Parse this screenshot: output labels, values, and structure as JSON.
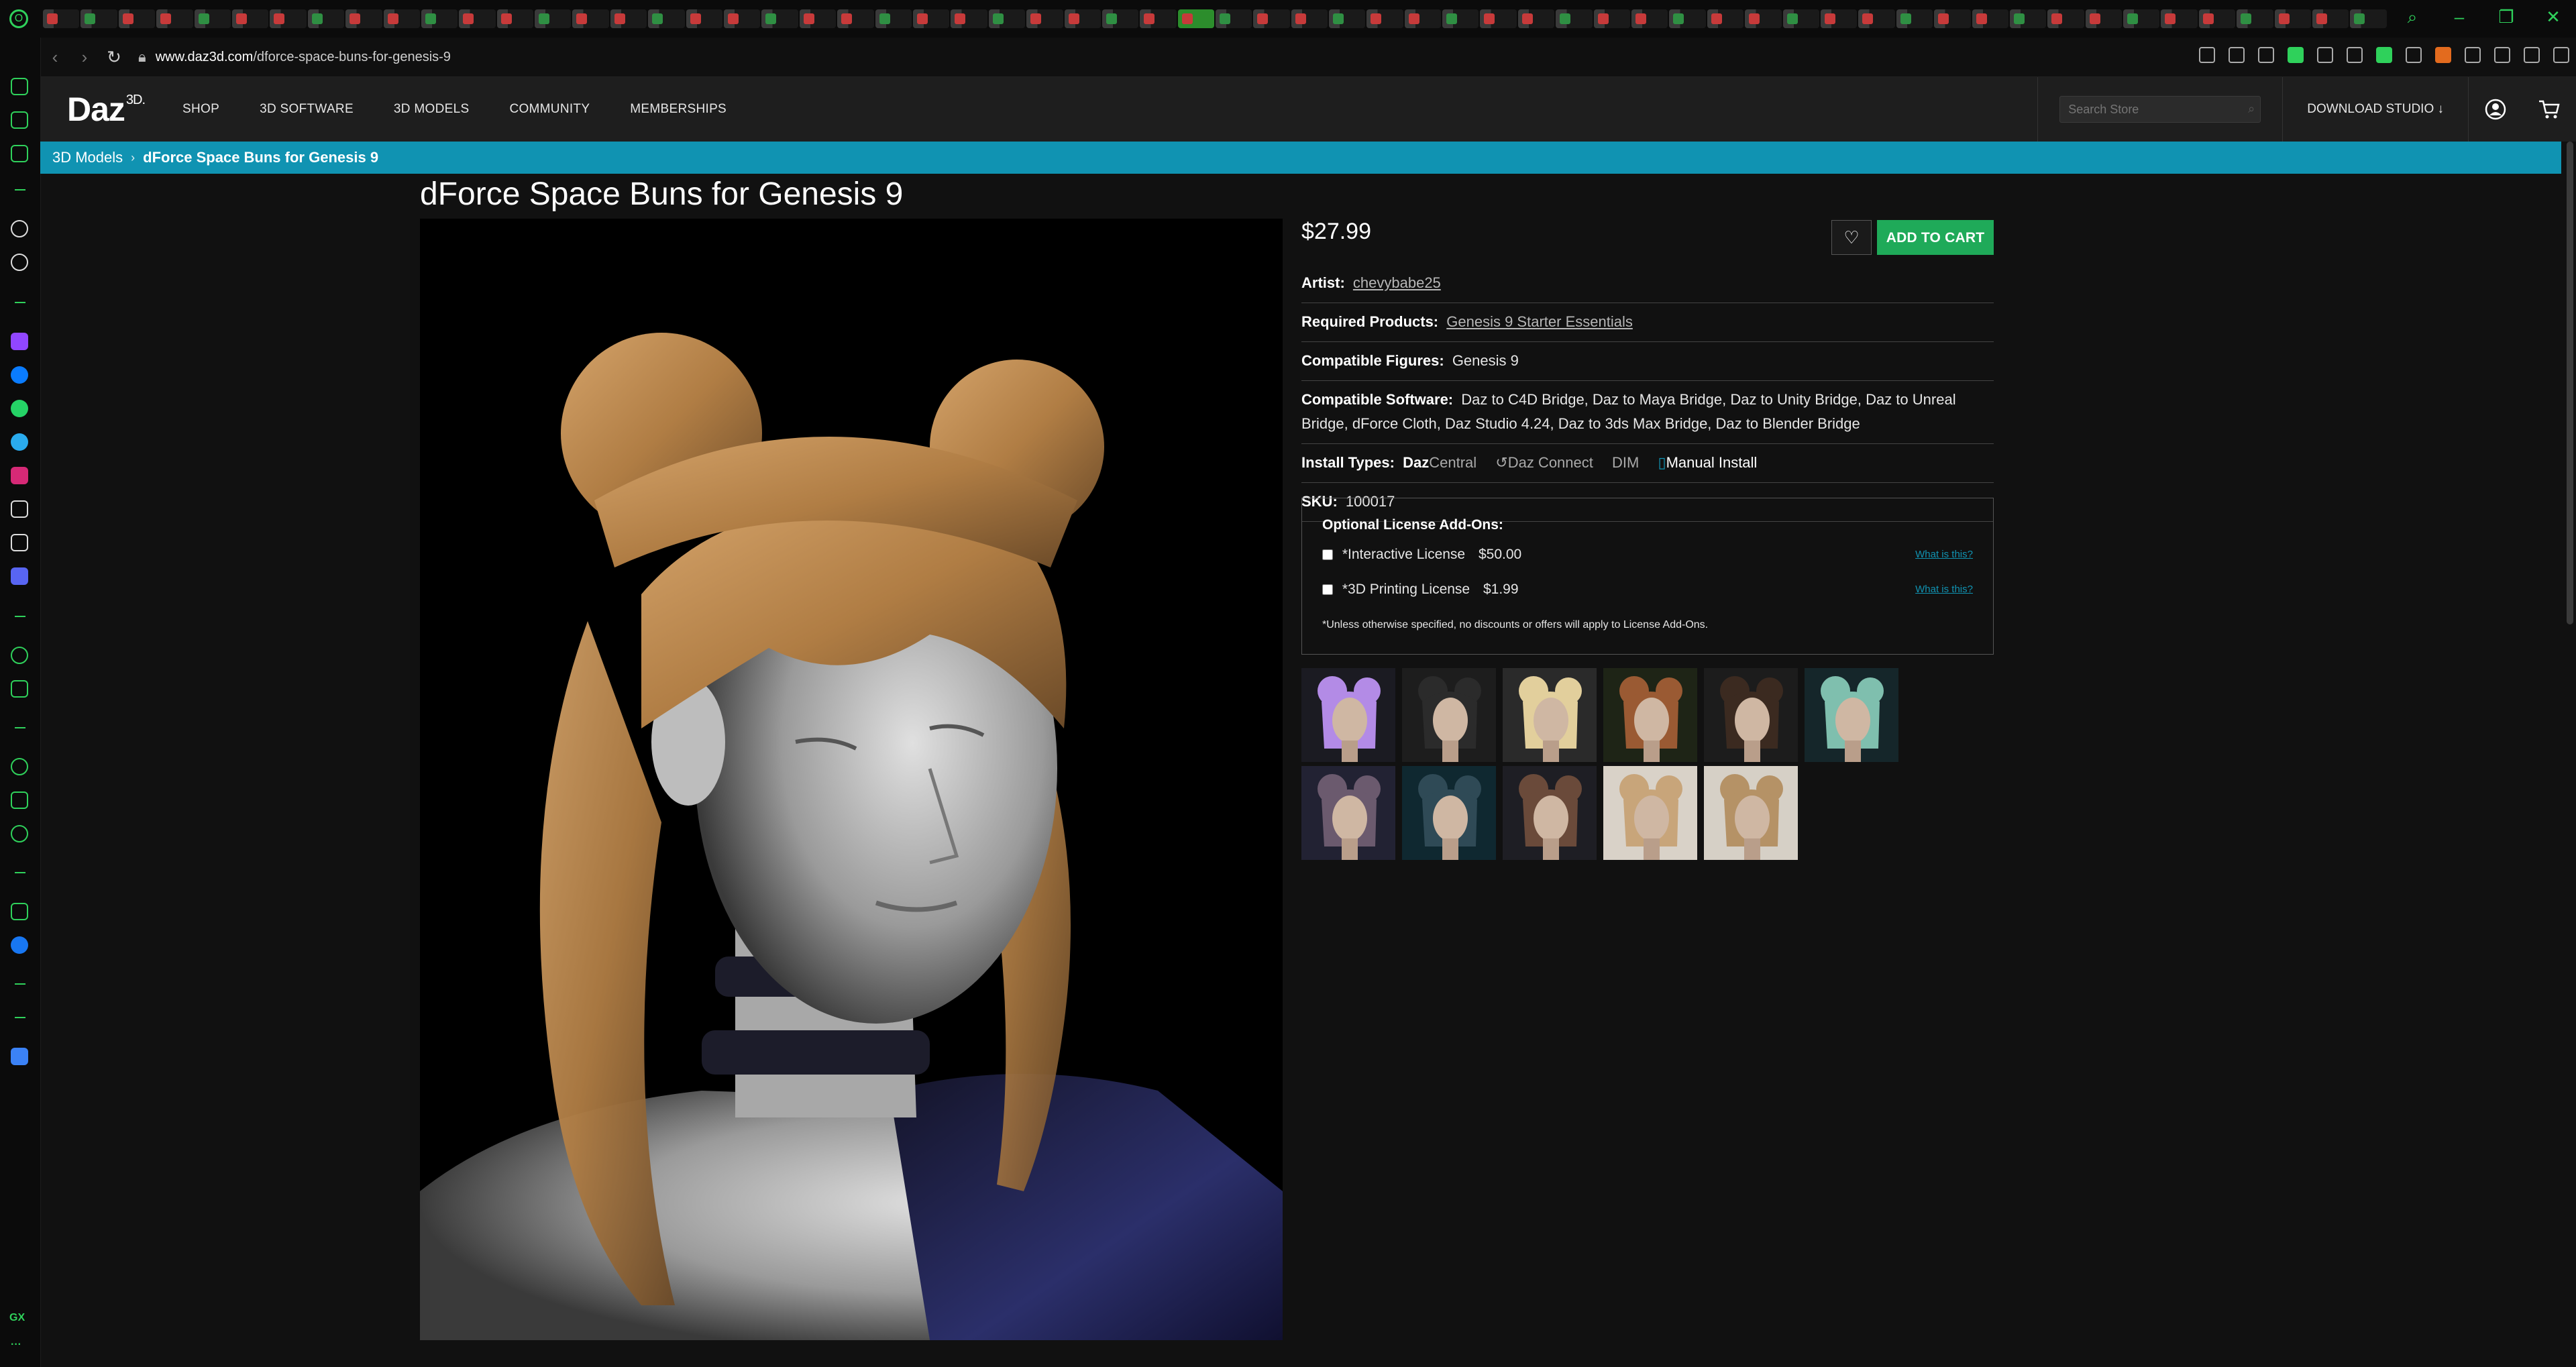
{
  "browser": {
    "url_domain": "www.daz3d.com",
    "url_path": "/dforce-space-buns-for-genesis-9",
    "sidebar_label": "GX",
    "sidebar_more": "···"
  },
  "header": {
    "logo": "Daz",
    "logo_sup": "3D.",
    "nav": [
      {
        "label": "SHOP"
      },
      {
        "label": "3D SOFTWARE"
      },
      {
        "label": "3D MODELS"
      },
      {
        "label": "COMMUNITY"
      },
      {
        "label": "MEMBERSHIPS"
      }
    ],
    "search_placeholder": "Search Store",
    "download_label": "DOWNLOAD STUDIO ↓"
  },
  "breadcrumb": {
    "parent": "3D Models",
    "separator": "›",
    "current": "dForce Space Buns for Genesis 9"
  },
  "product": {
    "title": "dForce Space Buns for Genesis 9",
    "price": "$27.99",
    "add_to_cart": "ADD TO CART",
    "artist_label": "Artist:",
    "artist": "chevybabe25",
    "required_label": "Required Products:",
    "required": "Genesis 9 Starter Essentials",
    "figures_label": "Compatible Figures:",
    "figures": "Genesis 9",
    "software_label": "Compatible Software:",
    "software": "Daz to C4D Bridge, Daz to Maya Bridge, Daz to Unity Bridge, Daz to Unreal Bridge, dForce Cloth, Daz Studio 4.24, Daz to 3ds Max Bridge, Daz to Blender Bridge",
    "install_label": "Install Types:",
    "install_daz": "Daz",
    "install_central": "Central",
    "install_connect": "Daz Connect",
    "install_dim": "DIM",
    "install_manual": "Manual Install",
    "sku_label": "SKU:",
    "sku": "100017"
  },
  "license": {
    "heading": "Optional License Add-Ons:",
    "items": [
      {
        "name": "*Interactive License",
        "price": "$50.00",
        "link": "What is this?"
      },
      {
        "name": "*3D Printing License",
        "price": "$1.99",
        "link": "What is this?"
      }
    ],
    "note": "*Unless otherwise specified, no discounts or offers will apply to License Add-Ons."
  },
  "colors": {
    "accent": "#1093b2",
    "cart_green": "#1faa59",
    "gx_green": "#2fd15b",
    "background": "#111111"
  },
  "icons": {
    "wishlist": "heart-icon",
    "account": "user-icon",
    "cart": "cart-icon",
    "search": "search-icon"
  }
}
